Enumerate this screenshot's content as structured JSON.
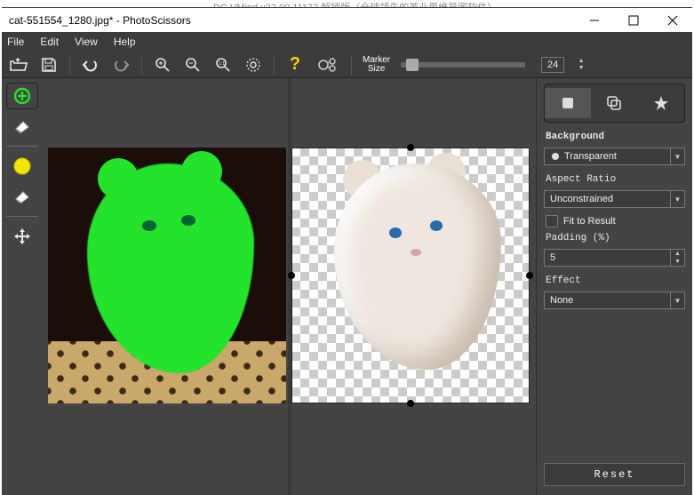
{
  "background_hint": "DC VMind v22.00.11172 解锁版（全球领先的英业思维导图软件）",
  "window": {
    "title": "cat-551554_1280.jpg* - PhotoScissors"
  },
  "menu": {
    "file": "File",
    "edit": "Edit",
    "view": "View",
    "help": "Help"
  },
  "toolbar": {
    "open": "open-icon",
    "save": "save-icon",
    "undo": "undo-icon",
    "redo": "redo-icon",
    "zoom_in": "zoom-in-icon",
    "zoom_out": "zoom-out-icon",
    "zoom_1to1": "zoom-1to1-icon",
    "zoom_fit": "zoom-fit-icon",
    "help": "help-icon",
    "auto": "auto-icon",
    "marker_label_l1": "Marker",
    "marker_label_l2": "Size",
    "marker_value": "24"
  },
  "lefttools": {
    "fg_marker": "foreground-marker",
    "fg_erase": "foreground-eraser",
    "bg_marker": "background-marker",
    "bg_erase": "background-eraser",
    "move": "move-tool"
  },
  "rightpanel": {
    "tab_bg": "background-tab",
    "tab_mask": "mask-tab",
    "tab_fav": "favorites-tab",
    "background_label": "Background",
    "background_value": "Transparent",
    "aspect_label": "Aspect Ratio",
    "aspect_value": "Unconstrained",
    "fit_label": "Fit to Result",
    "padding_label": "Padding (%)",
    "padding_value": "5",
    "effect_label": "Effect",
    "effect_value": "None",
    "reset": "Reset"
  }
}
